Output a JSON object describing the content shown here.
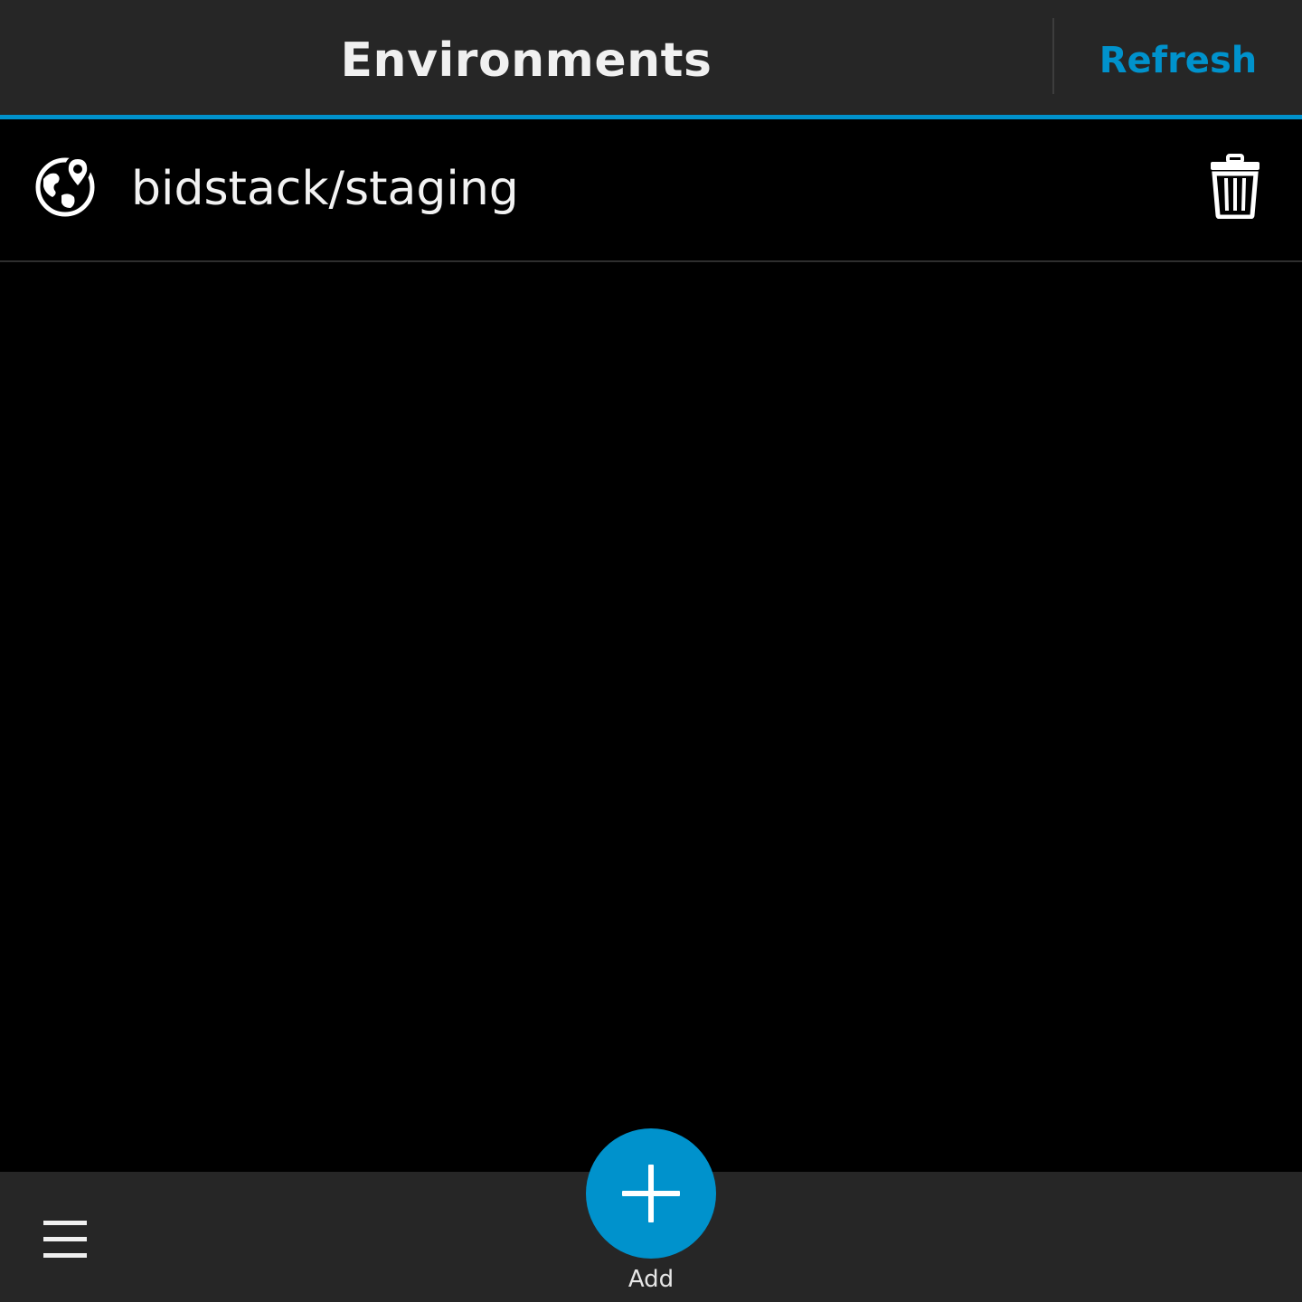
{
  "titlebar": {
    "title": "Environments",
    "refresh_label": "Refresh"
  },
  "environments": [
    {
      "label": "bidstack/staging",
      "icon": "globe-location-icon"
    }
  ],
  "actionbar": {
    "menu_icon": "hamburger-menu-icon",
    "add_label": "Add",
    "add_icon": "plus-icon"
  },
  "colors": {
    "accent": "#0092cc",
    "bar_background": "#262626",
    "page_background": "#000000",
    "text": "#f2f2f2"
  }
}
